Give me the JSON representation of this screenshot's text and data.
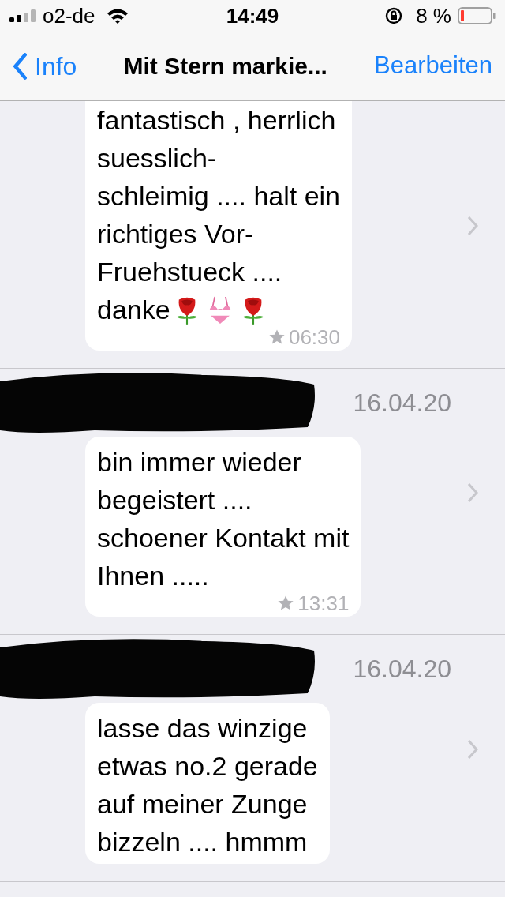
{
  "status_bar": {
    "carrier": "o2-de",
    "time": "14:49",
    "battery": "8 %"
  },
  "nav": {
    "back": "Info",
    "title": "Mit Stern markie...",
    "action": "Bearbeiten"
  },
  "sections": [
    {
      "message": {
        "text": "fantastisch , herrlich\nsuesslich-\nschleimig .... halt ein\nrichtiges Vor-\nFruehstueck ....\ndanke",
        "emojis": [
          {
            "kind": "rose"
          },
          {
            "kind": "bikini"
          },
          {
            "kind": "rose"
          }
        ],
        "time": "06:30"
      }
    },
    {
      "date": "16.04.20",
      "message": {
        "text": "bin immer wieder\nbegeistert  ....\nschoener Kontakt mit\nIhnen .....",
        "time": "13:31"
      }
    },
    {
      "date": "16.04.20",
      "message": {
        "text": "lasse das winzige\netwas no.2 gerade\nauf meiner Zunge\nbizzeln .... hmmm"
      }
    }
  ]
}
